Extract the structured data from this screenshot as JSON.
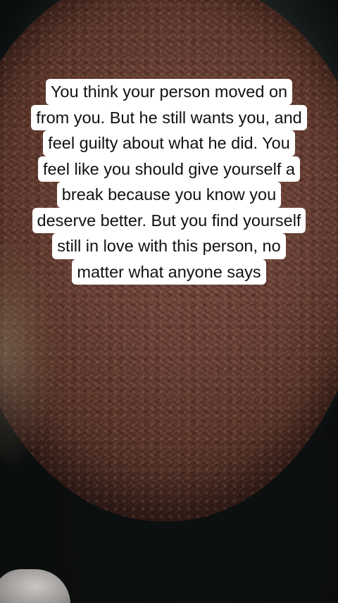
{
  "caption": {
    "lines": [
      "You think your person moved on",
      "from you. But he still wants you, and",
      "feel guilty about what he did. You",
      "feel like you should give yourself a",
      "break because you know you",
      "deserve better. But you find yourself",
      "still in love with this person, no",
      "matter what anyone says"
    ]
  },
  "colors": {
    "caption_background": "#ffffff",
    "caption_text": "#111111",
    "herb": "#6a4138",
    "bowl": "#2e3938"
  }
}
